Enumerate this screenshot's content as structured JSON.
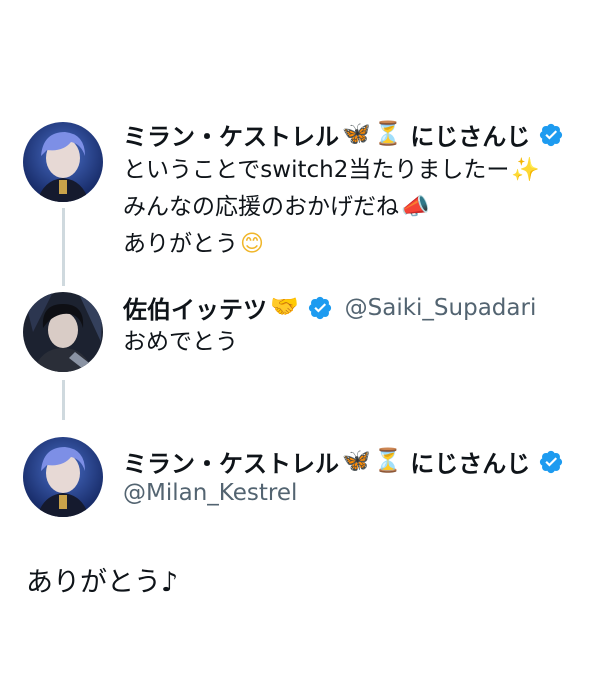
{
  "tweets": [
    {
      "author": {
        "name": "ミラン・ケストレル",
        "decor_icons": [
          "butterfly-icon",
          "hourglass-icon"
        ],
        "decor_glyphs": [
          "🦋",
          "⏳"
        ],
        "tag": "にじさんじ",
        "verified": true
      },
      "lines": [
        "ということでswitch2当たりましたー",
        "みんなの応援のおかげだね",
        "ありがとう"
      ],
      "emojis": [
        "✨",
        "📣",
        "😊"
      ]
    },
    {
      "author": {
        "name": "佐伯イッテツ",
        "decor_icons": [
          "handshake-icon"
        ],
        "decor_glyphs": [
          "🤝"
        ],
        "verified": true,
        "handle": "@Saiki_Supadari"
      },
      "lines": [
        "おめでとう"
      ]
    },
    {
      "author": {
        "name": "ミラン・ケストレル",
        "decor_icons": [
          "butterfly-icon",
          "hourglass-icon"
        ],
        "decor_glyphs": [
          "🦋",
          "⏳"
        ],
        "tag": "にじさんじ",
        "verified": true,
        "handle": "@Milan_Kestrel"
      }
    }
  ],
  "main_reply": "ありがとう♪",
  "colors": {
    "verified_blue": "#1d9bf0",
    "handle_gray": "#536471",
    "thread_line": "#cfd9de"
  }
}
